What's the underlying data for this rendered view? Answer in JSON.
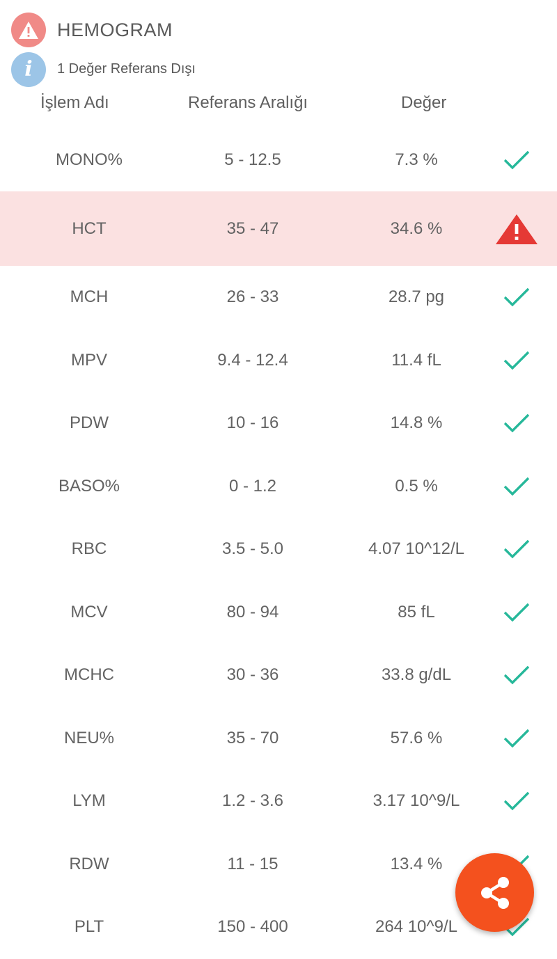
{
  "header": {
    "title": "HEMOGRAM",
    "warning_icon": "warning-icon",
    "info_icon": "info-icon",
    "info_text": "1 Değer Referans Dışı"
  },
  "columns": {
    "name": "İşlem Adı",
    "range": "Referans Aralığı",
    "value": "Değer"
  },
  "rows": [
    {
      "name": "MONO%",
      "range": "5 - 12.5",
      "value": "7.3 %",
      "status": "ok"
    },
    {
      "name": "HCT",
      "range": "35 - 47",
      "value": "34.6 %",
      "status": "alert"
    },
    {
      "name": "MCH",
      "range": "26 - 33",
      "value": "28.7 pg",
      "status": "ok"
    },
    {
      "name": "MPV",
      "range": "9.4 - 12.4",
      "value": "11.4 fL",
      "status": "ok"
    },
    {
      "name": "PDW",
      "range": "10 - 16",
      "value": "14.8 %",
      "status": "ok"
    },
    {
      "name": "BASO%",
      "range": "0 - 1.2",
      "value": "0.5 %",
      "status": "ok"
    },
    {
      "name": "RBC",
      "range": "3.5 - 5.0",
      "value": "4.07 10^12/L",
      "status": "ok"
    },
    {
      "name": "MCV",
      "range": "80 - 94",
      "value": "85 fL",
      "status": "ok"
    },
    {
      "name": "MCHC",
      "range": "30 - 36",
      "value": "33.8 g/dL",
      "status": "ok"
    },
    {
      "name": "NEU%",
      "range": "35 - 70",
      "value": "57.6 %",
      "status": "ok"
    },
    {
      "name": "LYM",
      "range": "1.2 - 3.6",
      "value": "3.17 10^9/L",
      "status": "ok"
    },
    {
      "name": "RDW",
      "range": "11 - 15",
      "value": "13.4 %",
      "status": "ok"
    },
    {
      "name": "PLT",
      "range": "150 - 400",
      "value": "264 10^9/L",
      "status": "ok"
    }
  ],
  "colors": {
    "ok": "#26b89a",
    "alert": "#e53935",
    "alert_row_bg": "#fbe1e1",
    "fab": "#f4511e"
  },
  "fab": {
    "icon": "share-icon"
  }
}
